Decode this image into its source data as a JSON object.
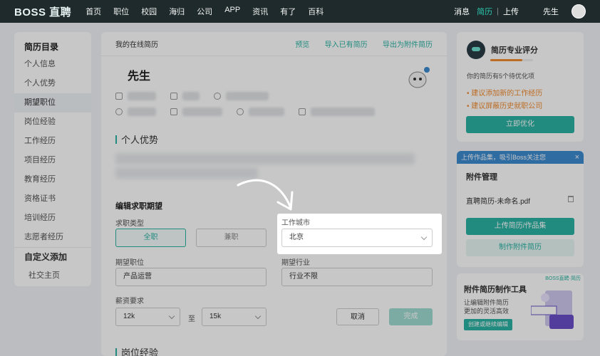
{
  "nav": {
    "logo": "BOSS 直聘",
    "items": [
      "首页",
      "职位",
      "校园",
      "海归",
      "公司",
      "APP",
      "资讯",
      "有了",
      "百科"
    ],
    "messages": "消息",
    "resume": "简历",
    "separator": "|",
    "upload": "上传",
    "user": "先生"
  },
  "sidebar": {
    "title": "简历目录",
    "items": [
      "个人信息",
      "个人优势",
      "期望职位",
      "岗位经验",
      "工作经历",
      "项目经历",
      "教育经历",
      "资格证书",
      "培训经历",
      "志愿者经历"
    ],
    "custom_title": "自定义添加",
    "social": "社交主页"
  },
  "resume": {
    "header": "我的在线简历",
    "actions": [
      "预览",
      "导入已有简历",
      "导出为附件简历"
    ],
    "name": "先生",
    "advantage_title": "个人优势",
    "edit": {
      "title": "编辑求职期望",
      "job_type_label": "求职类型",
      "full_time": "全职",
      "part_time": "兼职",
      "city_label": "工作城市",
      "city_value": "北京",
      "position_label": "期望职位",
      "position_value": "产品运营",
      "industry_label": "期望行业",
      "industry_value": "行业不限",
      "salary_label": "薪资要求",
      "salary_min": "12k",
      "salary_to": "至",
      "salary_max": "15k",
      "cancel": "取消",
      "done": "完成"
    },
    "next_section": "岗位经验"
  },
  "score": {
    "title": "简历专业评分",
    "desc": "你的简历有5个待优化项",
    "suggestions": [
      "建议添加新的工作经历",
      "建议屏蔽历史就职公司"
    ],
    "button": "立即优化",
    "progress": 0.75
  },
  "attach": {
    "banner": "上传作品集，吸引Boss关注您",
    "close": "×",
    "title": "附件管理",
    "file": "直聘简历-未命名.pdf",
    "upload_button": "上传简历/作品集",
    "make_button": "制作附件简历"
  },
  "tool": {
    "tag": "BOSS直聘·简历",
    "title": "附件简历制作工具",
    "desc1": "让编辑附件简历",
    "desc2": "更加的灵活高效",
    "button": "创建或继续编辑"
  },
  "colors": {
    "accent": "#2bb3a3",
    "nav_bg": "#1e2a2b",
    "warning": "#f28b2e",
    "banner": "#3c8bd0"
  }
}
